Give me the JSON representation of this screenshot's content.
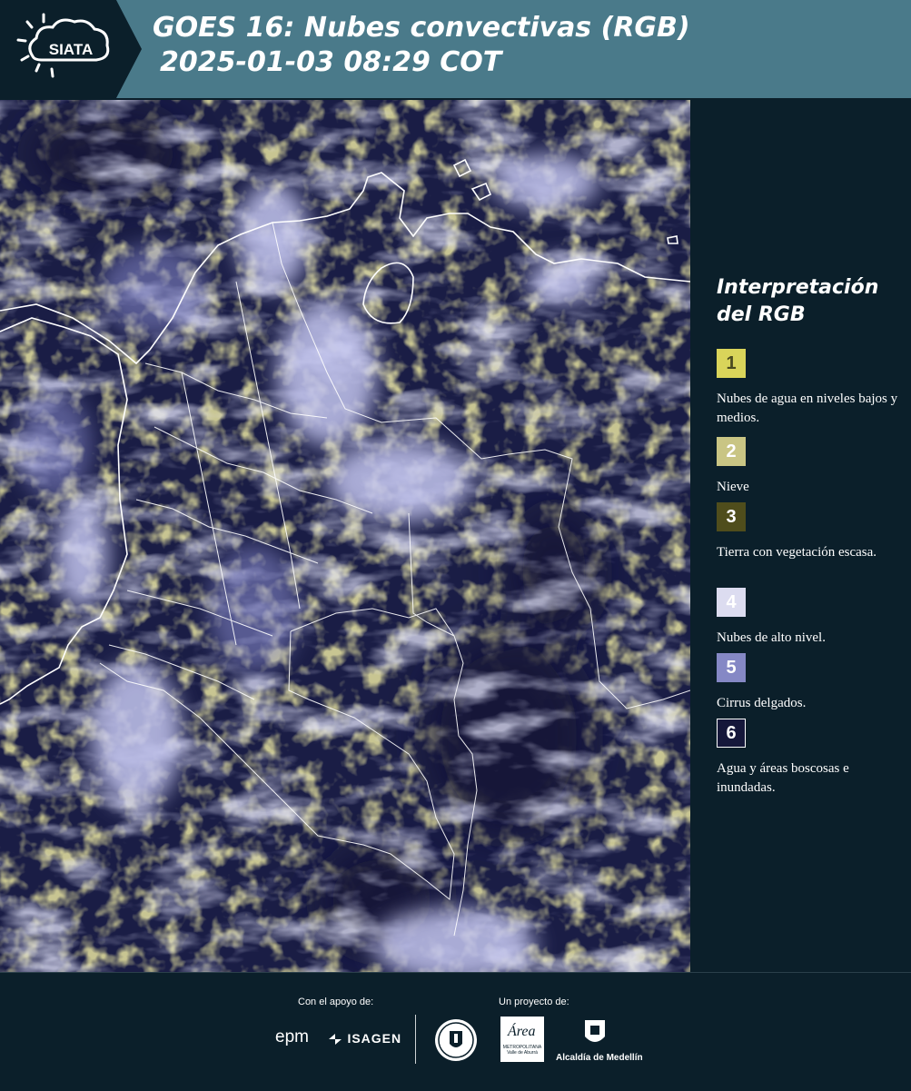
{
  "header": {
    "logo_text": "SIATA",
    "title_line1": "GOES 16: Nubes convectivas (RGB)",
    "title_line2": "2025-01-03 08:29 COT"
  },
  "legend": {
    "title": "Interpretación del RGB",
    "items": [
      {
        "number": "1",
        "label": "Nubes de agua en niveles bajos y medios.",
        "color": "#d9d45a",
        "number_color": "#4a4a20"
      },
      {
        "number": "2",
        "label": "Nieve",
        "color": "#c9c584",
        "number_color": "#ffffff"
      },
      {
        "number": "3",
        "label": "Tierra con vegetación escasa.",
        "color": "#4f4d1c",
        "number_color": "#ffffff"
      },
      {
        "number": "4",
        "label": "Nubes de alto nivel.",
        "color": "#dcdcf0",
        "number_color": "#ffffff"
      },
      {
        "number": "5",
        "label": "Cirrus delgados.",
        "color": "#8588c5",
        "number_color": "#ffffff"
      },
      {
        "number": "6",
        "label": "Agua y áreas boscosas e inundadas.",
        "color": "#15173a",
        "number_color": "#ffffff"
      }
    ]
  },
  "footer": {
    "support_label": "Con el apoyo de:",
    "project_label": "Un proyecto de:",
    "sponsors": [
      "epm",
      "ISAGEN"
    ],
    "partners": [
      "Alcaldía de Medellín"
    ],
    "area_logo_text": "Área",
    "area_sub_1": "METROPOLITANA",
    "area_sub_2": "Valle de Aburrá"
  },
  "colors": {
    "header_bg": "#4a7a8a",
    "logo_bg": "#0b1f2a",
    "page_bg": "#0b1f2a",
    "map_ocean": "#1a1d45",
    "cloud_high": "#b9bbe8",
    "cloud_low": "#c9c25a"
  }
}
